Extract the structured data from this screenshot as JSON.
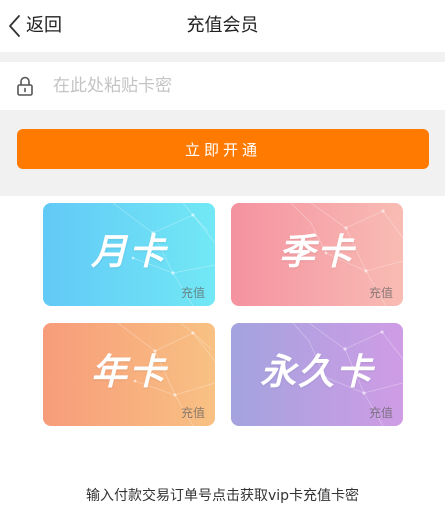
{
  "nav": {
    "back_label": "返回",
    "title": "充值会员",
    "back_icon": "chevron-left-icon"
  },
  "redeem": {
    "placeholder": "在此处粘贴卡密",
    "input_value": "",
    "lock_icon": "lock-icon",
    "button_label": "立即开通"
  },
  "cards": [
    {
      "name": "月卡",
      "tag": "充值",
      "colors": [
        "#62c9f6",
        "#72e8f5"
      ]
    },
    {
      "name": "季卡",
      "tag": "充值",
      "colors": [
        "#f592a0",
        "#f8bcb4"
      ]
    },
    {
      "name": "年卡",
      "tag": "充值",
      "colors": [
        "#f79c7a",
        "#f8c183"
      ]
    },
    {
      "name": "永久卡",
      "tag": "充值",
      "colors": [
        "#a3a3df",
        "#cf9ce5"
      ]
    }
  ],
  "tip": "输入付款交易订单号点击获取vip卡充值卡密",
  "colors": {
    "accent": "#ff7a00",
    "band_bg": "#f1f1f1",
    "placeholder": "#c4c4c4"
  }
}
